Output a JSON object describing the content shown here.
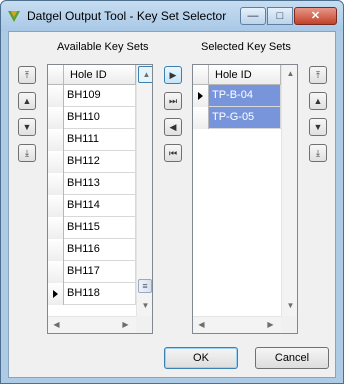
{
  "window": {
    "title": "Datgel Output Tool - Key Set Selector",
    "minimize_glyph": "—",
    "maximize_glyph": "□",
    "close_glyph": "✕"
  },
  "available": {
    "label": "Available Key Sets",
    "column_header": "Hole ID",
    "rows": [
      "BH109",
      "BH110",
      "BH111",
      "BH112",
      "BH113",
      "BH114",
      "BH115",
      "BH116",
      "BH117",
      "BH118"
    ],
    "current_row": "BH118",
    "move_top_glyph": "⤒",
    "move_up_glyph": "▲",
    "move_down_glyph": "▼",
    "move_bottom_glyph": "⤓"
  },
  "transfer": {
    "add_glyph": "▶",
    "add_all_glyph": "⏭",
    "remove_glyph": "◀",
    "remove_all_glyph": "⏮"
  },
  "selected": {
    "label": "Selected Key Sets",
    "column_header": "Hole ID",
    "rows": [
      "TP-B-04",
      "TP-G-05"
    ],
    "move_top_glyph": "⤒",
    "move_up_glyph": "▲",
    "move_down_glyph": "▼",
    "move_bottom_glyph": "⤓"
  },
  "scroll": {
    "up_glyph": "▲",
    "down_glyph": "▼",
    "left_glyph": "◀",
    "right_glyph": "▶",
    "grip_glyph": "≡"
  },
  "buttons": {
    "ok": "OK",
    "cancel": "Cancel"
  },
  "colors": {
    "selection": "#7895db",
    "title_bar": "#aecbe6"
  }
}
